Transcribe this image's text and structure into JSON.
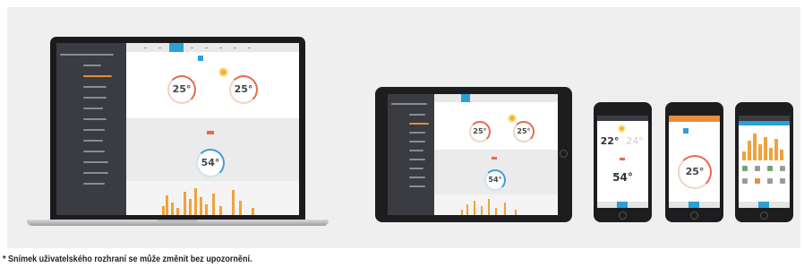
{
  "footnote": "* Snímek uživatelského rozhraní se může změnit bez upozornění.",
  "devices": [
    {
      "type": "laptop",
      "gauges": [
        "25°",
        "25°",
        "54°"
      ]
    },
    {
      "type": "tablet",
      "gauges": [
        "25°",
        "25°",
        "54°"
      ]
    },
    {
      "type": "phone",
      "gauges": [
        "22°",
        "24°",
        "54°"
      ]
    },
    {
      "type": "phone",
      "gauges": [
        "25°"
      ]
    },
    {
      "type": "phone",
      "gauges": []
    }
  ],
  "colors": {
    "accent": "#2b9fd9",
    "warm": "#e66a4b",
    "bars": "#f0a23c",
    "sidebar": "#3a3c41",
    "panel": "#efefef"
  }
}
